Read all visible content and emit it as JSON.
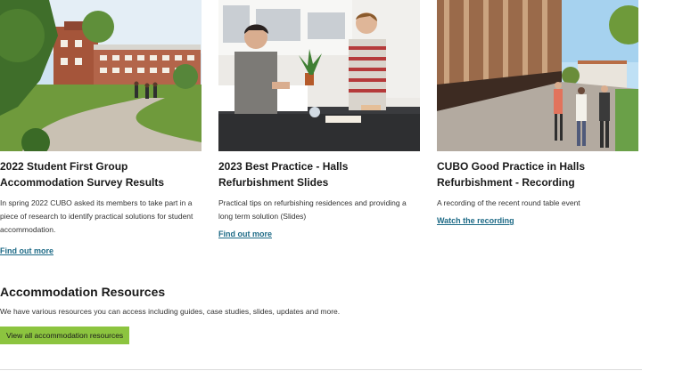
{
  "cards": [
    {
      "title": "2022 Student First Group Accommodation Survey Results",
      "text": "In spring 2022 CUBO asked its members to take part in a piece of research to identify practical solutions for student accommodation.",
      "link": "Find out more"
    },
    {
      "title": "2023 Best Practice - Halls Refurbishment Slides",
      "text": "Practical tips on refurbishing residences and providing a long term solution (Slides)",
      "link": "Find out more"
    },
    {
      "title": "CUBO Good Practice in Halls Refurbishment - Recording",
      "text": "A recording of the recent round table event",
      "link": "Watch the recording"
    }
  ],
  "resources": {
    "title": "Accommodation Resources",
    "text": "We have various resources you can access including guides, case studies, slides, updates and more.",
    "button": "View all accommodation resources"
  },
  "colors": {
    "link": "#1d6a86",
    "button": "#8cc43f",
    "divider": "#dcdcdc"
  }
}
